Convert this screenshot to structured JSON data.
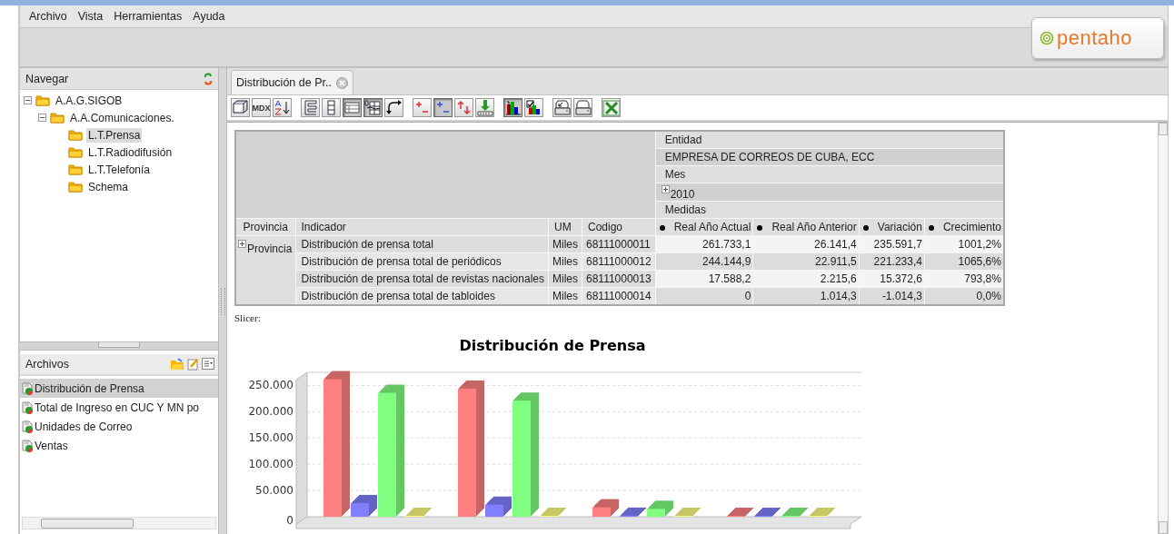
{
  "menu": [
    "Archivo",
    "Vista",
    "Herramientas",
    "Ayuda"
  ],
  "logo": {
    "text": "pentaho"
  },
  "navigator": {
    "title": "Navegar",
    "tree": [
      {
        "label": "A.A.G.SIGOB",
        "selected": false,
        "expanded": true,
        "children": [
          {
            "label": "A.A.Comunicaciones.",
            "selected": false,
            "expanded": true,
            "children": [
              {
                "label": "L.T.Prensa",
                "selected": true
              },
              {
                "label": "L.T.Radiodifusión",
                "selected": false
              },
              {
                "label": "L.T.Telefonía",
                "selected": false
              },
              {
                "label": "Schema",
                "selected": false
              }
            ]
          }
        ]
      }
    ]
  },
  "files": {
    "title": "Archivos",
    "items": [
      {
        "label": "Distribución de Prensa",
        "selected": true
      },
      {
        "label": "Total de Ingreso en CUC Y MN po",
        "selected": false
      },
      {
        "label": "Unidades de Correo",
        "selected": false
      },
      {
        "label": "Ventas",
        "selected": false
      }
    ]
  },
  "tabs": [
    {
      "label": "Distribución de Pr..",
      "selected": true
    }
  ],
  "toolbar": [
    [
      {
        "kind": "cube",
        "pressed": false
      },
      {
        "kind": "text",
        "label": "MDX",
        "pressed": false
      },
      {
        "kind": "sort",
        "pressed": false
      }
    ],
    [
      {
        "kind": "tree",
        "pressed": false
      },
      {
        "kind": "columns",
        "pressed": false
      },
      {
        "kind": "table",
        "pressed": true
      },
      {
        "kind": "grid",
        "pressed": true
      },
      {
        "kind": "swap",
        "pressed": false
      }
    ],
    [
      {
        "kind": "plusminus-red",
        "pressed": false
      },
      {
        "kind": "plusminus-blue",
        "pressed": true
      },
      {
        "kind": "updown",
        "pressed": false
      },
      {
        "kind": "download",
        "pressed": false
      }
    ],
    [
      {
        "kind": "barchart",
        "pressed": true
      },
      {
        "kind": "chartcheck",
        "pressed": false
      }
    ],
    [
      {
        "kind": "printsetup",
        "pressed": false
      },
      {
        "kind": "print",
        "pressed": false
      }
    ],
    [
      {
        "kind": "excel",
        "pressed": false
      }
    ]
  ],
  "pivot": {
    "column_dims": [
      {
        "kind": "dimension",
        "label": "Entidad"
      },
      {
        "kind": "member",
        "label": "EMPRESA DE CORREOS DE CUBA, ECC"
      },
      {
        "kind": "dimension",
        "label": "Mes"
      },
      {
        "kind": "member",
        "label": "2010",
        "expanded": false
      },
      {
        "kind": "dimension",
        "label": "Medidas"
      }
    ],
    "row_headers": [
      "Provincia",
      "Indicador",
      "UM",
      "Codigo"
    ],
    "measures": [
      "Real Año Actual",
      "Real Año Anterior",
      "Variación",
      "Crecimiento"
    ],
    "row_member": {
      "label": "Provincia",
      "expanded": false
    },
    "rows": [
      {
        "indicador": "Distribución de prensa total",
        "um": "Miles",
        "codigo": "68111000011",
        "values": [
          "261.733,1",
          "26.141,4",
          "235.591,7",
          "1001,2%"
        ]
      },
      {
        "indicador": "Distribución de prensa total de periódicos",
        "um": "Miles",
        "codigo": "68111000012",
        "values": [
          "244.144,9",
          "22.911,5",
          "221.233,4",
          "1065,6%"
        ]
      },
      {
        "indicador": "Distribución de prensa total de revistas nacionales",
        "um": "Miles",
        "codigo": "68111000013",
        "values": [
          "17.588,2",
          "2.215,6",
          "15.372,6",
          "793,8%"
        ]
      },
      {
        "indicador": "Distribución de prensa total de tabloides",
        "um": "Miles",
        "codigo": "68111000014",
        "values": [
          "0",
          "1.014,3",
          "-1.014,3",
          "0,0%"
        ]
      }
    ]
  },
  "slicer": "Slicer:",
  "chart": {
    "chart_data": {
      "type": "bar",
      "title": "Distribución de Prensa",
      "ylim": [
        -2000,
        275000
      ],
      "grid": true,
      "yticks": [
        {
          "value": 0,
          "label": "0"
        },
        {
          "value": 50000,
          "label": "50.000"
        },
        {
          "value": 100000,
          "label": "100.000"
        },
        {
          "value": 150000,
          "label": "150.000"
        },
        {
          "value": 200000,
          "label": "200.000"
        },
        {
          "value": 250000,
          "label": "250.000"
        }
      ],
      "series": [
        {
          "color": "#ff8080",
          "values": [
            262000,
            244000,
            18000,
            0
          ]
        },
        {
          "color": "#8080ff",
          "values": [
            26000,
            23000,
            2000,
            1000
          ]
        },
        {
          "color": "#80ff80",
          "values": [
            236000,
            221000,
            15000,
            -1000
          ]
        },
        {
          "color": "#ffff80",
          "values": [
            1000,
            1000,
            1000,
            0
          ]
        }
      ]
    }
  }
}
